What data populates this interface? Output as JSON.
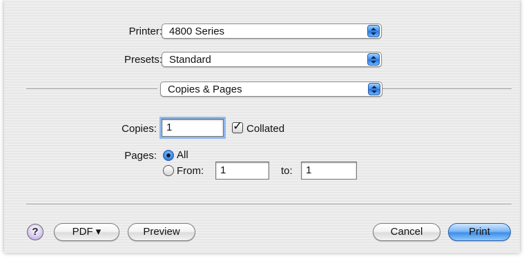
{
  "printer": {
    "label": "Printer:",
    "value": "4800 Series"
  },
  "presets": {
    "label": "Presets:",
    "value": "Standard"
  },
  "panel": {
    "value": "Copies & Pages"
  },
  "copies": {
    "label": "Copies:",
    "value": "1",
    "collated_label": "Collated",
    "collated_checked": true
  },
  "pages": {
    "label": "Pages:",
    "all_label": "All",
    "from_label": "From:",
    "from_value": "1",
    "to_label": "to:",
    "to_value": "1",
    "selected": "All"
  },
  "buttons": {
    "help": "?",
    "pdf": "PDF ▾",
    "preview": "Preview",
    "cancel": "Cancel",
    "print": "Print"
  },
  "colors": {
    "accent": "#3a8ef0",
    "background": "#ececec"
  }
}
